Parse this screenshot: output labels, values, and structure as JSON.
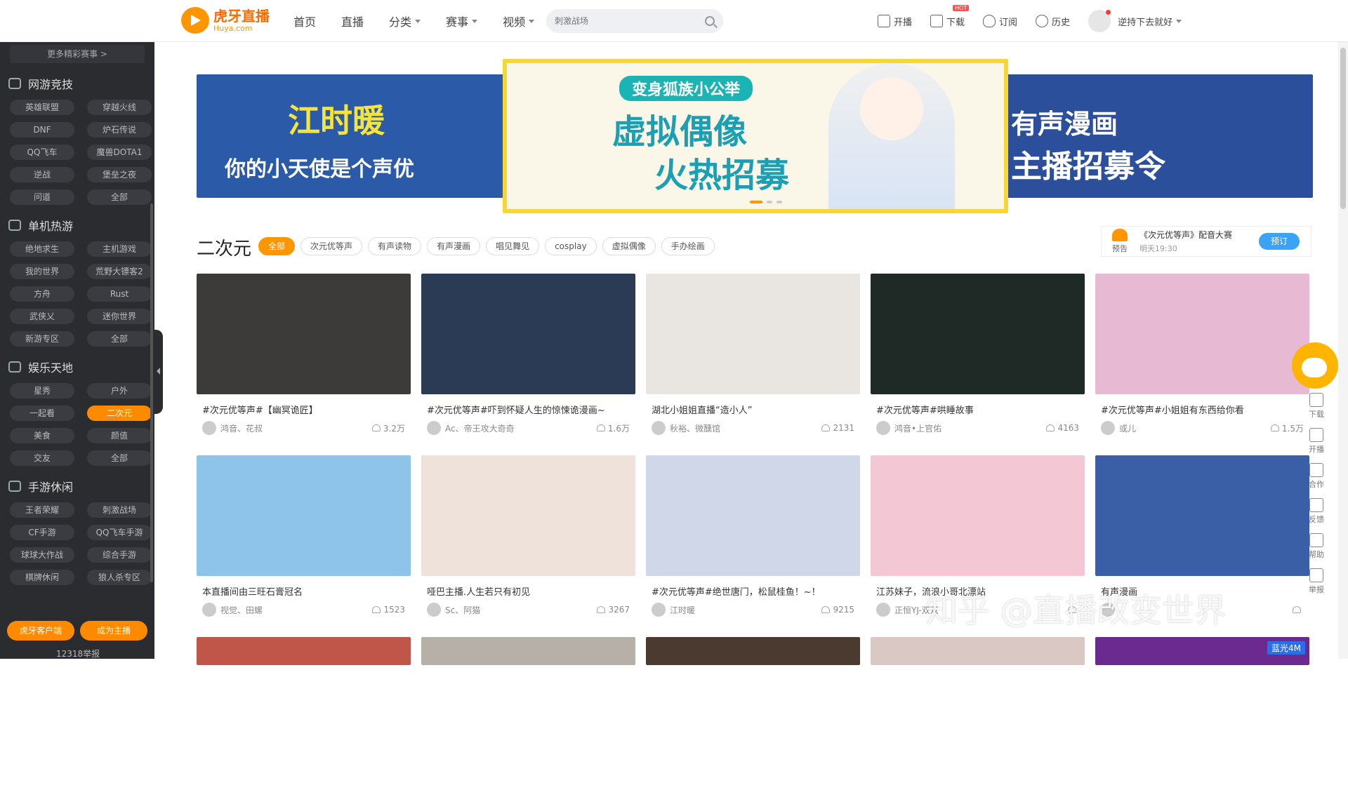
{
  "logo": {
    "cn": "虎牙直播",
    "en": "Huya.com"
  },
  "nav": [
    {
      "label": "首页",
      "dropdown": false
    },
    {
      "label": "直播",
      "dropdown": false
    },
    {
      "label": "分类",
      "dropdown": true
    },
    {
      "label": "赛事",
      "dropdown": true
    },
    {
      "label": "视频",
      "dropdown": true
    }
  ],
  "search": {
    "placeholder": "刺激战场"
  },
  "header_right": {
    "broadcast": "开播",
    "download": "下载",
    "hot": "HOT",
    "subscribe": "订阅",
    "history": "历史",
    "username": "逆持下去就好"
  },
  "sidebar": {
    "more_events": "更多精彩赛事 >",
    "groups": [
      {
        "title": "网游竞技",
        "items": [
          "英雄联盟",
          "穿越火线",
          "DNF",
          "炉石传说",
          "QQ飞车",
          "魔兽DOTA1",
          "逆战",
          "堡垒之夜",
          "问道",
          "全部"
        ]
      },
      {
        "title": "单机热游",
        "items": [
          "绝地求生",
          "主机游戏",
          "我的世界",
          "荒野大镖客2",
          "方舟",
          "Rust",
          "武侠乂",
          "迷你世界",
          "新游专区",
          "全部"
        ]
      },
      {
        "title": "娱乐天地",
        "items": [
          "星秀",
          "户外",
          "一起看",
          "二次元",
          "美食",
          "颜值",
          "交友",
          "全部"
        ]
      },
      {
        "title": "手游休闲",
        "items": [
          "王者荣耀",
          "刺激战场",
          "CF手游",
          "QQ飞车手游",
          "球球大作战",
          "综合手游",
          "棋牌休闲",
          "狼人杀专区"
        ]
      }
    ],
    "active_item": "二次元",
    "client_button": "虎牙客户端",
    "anchor_button": "成为主播",
    "report": "12318举报"
  },
  "banners": {
    "left": {
      "line1": "江时暖",
      "line2": "你的小天使是个声优"
    },
    "center": {
      "tag": "变身狐族小公举",
      "line1": "虚拟偶像",
      "line2": "火热招募"
    },
    "right": {
      "line1": "有声漫画",
      "line2": "主播招募令"
    }
  },
  "section": {
    "title": "二次元",
    "tags": [
      "全部",
      "次元优等声",
      "有声读物",
      "有声漫画",
      "唱见舞见",
      "cosplay",
      "虚拟偶像",
      "手办绘画"
    ],
    "active_tag": "全部"
  },
  "preview": {
    "label": "预告",
    "title": "《次元优等声》配音大赛",
    "time": "明天19:30",
    "button": "预订"
  },
  "cards": [
    {
      "title": "#次元优等声#【幽冥诡匠】",
      "host": "鸿音、花叔",
      "viewers": "3.2万",
      "color": "#3d3a3a"
    },
    {
      "title": "#次元优等声#吓到怀疑人生的惊悚诡漫画~",
      "host": "Ac、帝王攻大奇奇",
      "viewers": "1.6万",
      "color": "#2b3a55"
    },
    {
      "title": "湖北小姐姐直播“造小人”",
      "host": "秋裕、微醺馆",
      "viewers": "2131",
      "color": "#e9e6e2"
    },
    {
      "title": "#次元优等声#哄睡故事",
      "host": "鸿音•上官佑",
      "viewers": "4163",
      "color": "#1f2a26"
    },
    {
      "title": "#次元优等声#小姐姐有东西给你看",
      "host": "或儿",
      "viewers": "1.5万",
      "color": "#e7b9d2"
    },
    {
      "title": "本直播间由三旺石膏冠名",
      "host": "视觉、田螺",
      "viewers": "1523",
      "color": "#8ec4ea"
    },
    {
      "title": "哑巴主播.人生若只有初见",
      "host": "Sc、阿猫",
      "viewers": "3267",
      "color": "#efe2da"
    },
    {
      "title": "#次元优等声#绝世唐门，松鼠桂鱼！~！",
      "host": "江时暖",
      "viewers": "9215",
      "color": "#cfd7e8"
    },
    {
      "title": "江苏妹子，流浪小哥北漂站",
      "host": "正恒YJ-双双",
      "viewers": "",
      "color": "#f3c7d3"
    },
    {
      "title": "有声漫画",
      "host": "",
      "viewers": "",
      "color": "#3a5fa6"
    },
    {
      "title": "",
      "host": "",
      "viewers": "",
      "color": "#c0564a"
    },
    {
      "title": "",
      "host": "",
      "viewers": "",
      "color": "#b7b0a8"
    },
    {
      "title": "",
      "host": "",
      "viewers": "",
      "color": "#4a3a30"
    },
    {
      "title": "",
      "host": "",
      "viewers": "",
      "color": "#d9c8c3"
    },
    {
      "title": "",
      "host": "",
      "viewers": "",
      "color": "#6a2a8f",
      "badge": "蓝光4M"
    }
  ],
  "rail": [
    "下载",
    "开播",
    "合作",
    "反馈",
    "帮助",
    "举报"
  ],
  "watermark": "知乎 @直播改变世界"
}
